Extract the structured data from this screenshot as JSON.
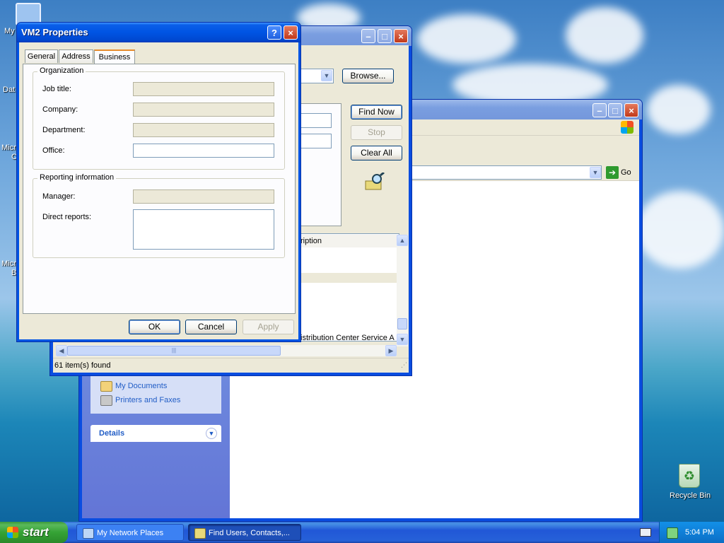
{
  "desktop": {
    "icons": [
      {
        "label": "My",
        "name": "my-computer-icon"
      },
      {
        "label": "Dat",
        "name": "database-icon"
      },
      {
        "label": "Micr",
        "name": "microsoft-icon-1"
      },
      {
        "label": "C",
        "name": "microsoft-icon-1b"
      },
      {
        "label": "Micr",
        "name": "microsoft-icon-2"
      },
      {
        "label": "B",
        "name": "microsoft-icon-2b"
      },
      {
        "label": "Recycle Bin",
        "name": "recycle-bin-icon"
      }
    ]
  },
  "explorer": {
    "go_label": "Go",
    "sidebar_links": [
      "My Documents",
      "Printers and Faxes"
    ],
    "details_label": "Details"
  },
  "find": {
    "browse_label": "Browse...",
    "find_now_label": "Find Now",
    "stop_label": "Stop",
    "clear_all_label": "Clear All",
    "column_header": "ription",
    "row_text": "istribution Center Service A",
    "status": "61 item(s) found"
  },
  "props": {
    "title": "VM2 Properties",
    "help_label": "?",
    "tabs": [
      "General",
      "Address",
      "Business"
    ],
    "active_tab": "Business",
    "organization": {
      "legend": "Organization",
      "job_title_label": "Job title:",
      "company_label": "Company:",
      "department_label": "Department:",
      "office_label": "Office:"
    },
    "reporting": {
      "legend": "Reporting information",
      "manager_label": "Manager:",
      "direct_reports_label": "Direct reports:"
    },
    "ok_label": "OK",
    "cancel_label": "Cancel",
    "apply_label": "Apply"
  },
  "taskbar": {
    "start_label": "start",
    "tasks": [
      "My Network Places",
      "Find Users, Contacts,..."
    ],
    "clock": "5:04 PM"
  },
  "colors": {
    "xp_blue": "#0054e3",
    "start_green": "#35a335",
    "dialog_face": "#ece9d8",
    "link_blue": "#215dc6"
  }
}
